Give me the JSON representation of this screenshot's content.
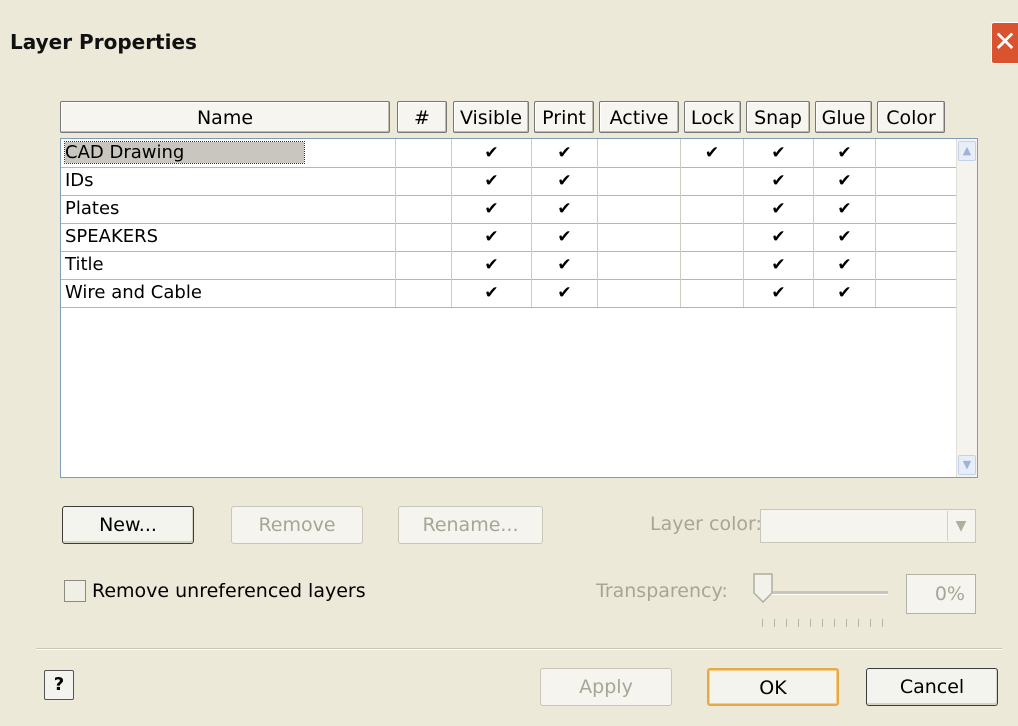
{
  "window": {
    "title": "Layer Properties"
  },
  "grid": {
    "columns": [
      "Name",
      "#",
      "Visible",
      "Print",
      "Active",
      "Lock",
      "Snap",
      "Glue",
      "Color"
    ],
    "rows": [
      {
        "name": "CAD Drawing",
        "number": "",
        "visible": "✔",
        "print": "✔",
        "active": "",
        "lock": "✔",
        "snap": "✔",
        "glue": "✔",
        "color": ""
      },
      {
        "name": "IDs",
        "number": "",
        "visible": "✔",
        "print": "✔",
        "active": "",
        "lock": "",
        "snap": "✔",
        "glue": "✔",
        "color": ""
      },
      {
        "name": "Plates",
        "number": "",
        "visible": "✔",
        "print": "✔",
        "active": "",
        "lock": "",
        "snap": "✔",
        "glue": "✔",
        "color": ""
      },
      {
        "name": "SPEAKERS",
        "number": "",
        "visible": "✔",
        "print": "✔",
        "active": "",
        "lock": "",
        "snap": "✔",
        "glue": "✔",
        "color": ""
      },
      {
        "name": "Title",
        "number": "",
        "visible": "✔",
        "print": "✔",
        "active": "",
        "lock": "",
        "snap": "✔",
        "glue": "✔",
        "color": ""
      },
      {
        "name": "Wire and Cable",
        "number": "",
        "visible": "✔",
        "print": "✔",
        "active": "",
        "lock": "",
        "snap": "✔",
        "glue": "✔",
        "color": ""
      }
    ],
    "selected_row": 0
  },
  "buttons": {
    "new": "New...",
    "remove": "Remove",
    "rename": "Rename...",
    "apply": "Apply",
    "ok": "OK",
    "cancel": "Cancel",
    "help": "?"
  },
  "layer_color": {
    "label": "Layer color:",
    "value": ""
  },
  "remove_unreferenced": {
    "label": "Remove unreferenced layers",
    "checked": false
  },
  "transparency": {
    "label": "Transparency:",
    "value": "0%"
  },
  "colors": {
    "accent_default": "#e9a848",
    "close_button": "#d9532f",
    "dialog_bg": "#ece9d8"
  },
  "icons": {
    "close": "close-icon",
    "check": "check-icon",
    "help": "help-icon"
  }
}
